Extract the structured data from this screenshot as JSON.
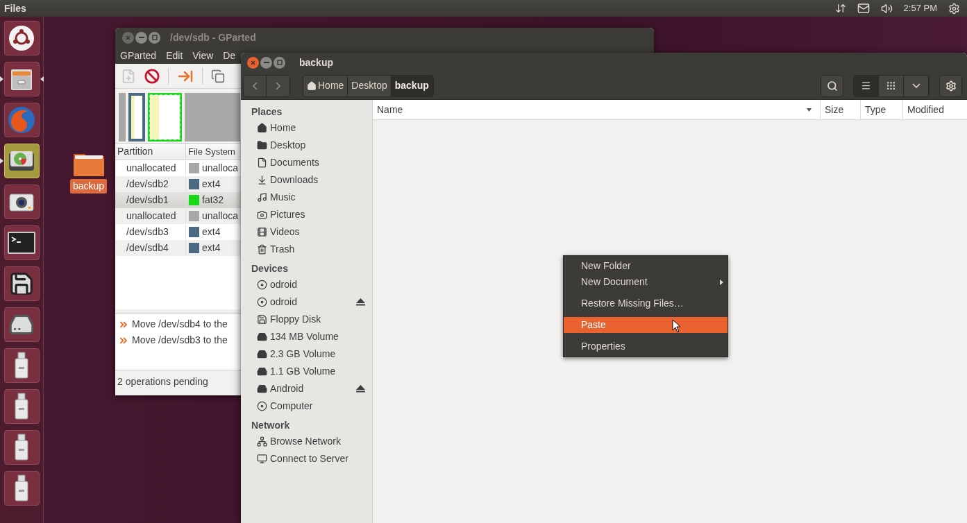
{
  "top_bar": {
    "app_name": "Files",
    "clock": "2:57 PM"
  },
  "launcher": [
    {
      "kind": "dash",
      "running": false,
      "focused": false
    },
    {
      "kind": "files",
      "running": true,
      "focused": true
    },
    {
      "kind": "browser",
      "running": false,
      "focused": false
    },
    {
      "kind": "gparted",
      "running": true,
      "focused": false
    },
    {
      "kind": "camera",
      "running": false,
      "focused": false
    },
    {
      "kind": "terminal",
      "running": false,
      "focused": false
    },
    {
      "kind": "floppy",
      "running": false,
      "focused": false
    },
    {
      "kind": "disk",
      "running": false,
      "focused": false
    },
    {
      "kind": "usb",
      "running": false,
      "focused": false
    },
    {
      "kind": "usb",
      "running": false,
      "focused": false
    },
    {
      "kind": "usb",
      "running": false,
      "focused": false
    },
    {
      "kind": "usb",
      "running": false,
      "focused": false
    }
  ],
  "desktop_icons": [
    {
      "label": "backup",
      "selected": true
    }
  ],
  "gparted": {
    "title": "/dev/sdb - GParted",
    "menu": [
      "GParted",
      "Edit",
      "View",
      "De"
    ],
    "columns": [
      "Partition",
      "File System"
    ],
    "rows": [
      {
        "partition": "unallocated",
        "filesystem": "unalloca",
        "color": "#a8a8a8",
        "selected": false
      },
      {
        "partition": "/dev/sdb2",
        "filesystem": "ext4",
        "color": "#4b6983",
        "selected": false
      },
      {
        "partition": "/dev/sdb1",
        "filesystem": "fat32",
        "color": "#18d918",
        "selected": true
      },
      {
        "partition": "unallocated",
        "filesystem": "unalloca",
        "color": "#a8a8a8",
        "selected": false
      },
      {
        "partition": "/dev/sdb3",
        "filesystem": "ext4",
        "color": "#4b6983",
        "selected": false
      },
      {
        "partition": "/dev/sdb4",
        "filesystem": "ext4",
        "color": "#4b6983",
        "selected": false
      }
    ],
    "operations": [
      "Move /dev/sdb4 to the",
      "Move /dev/sdb3 to the"
    ],
    "status": "2 operations pending"
  },
  "files": {
    "title": "backup",
    "path": [
      {
        "label": "Home",
        "kind": "home",
        "selected": false
      },
      {
        "label": "Desktop",
        "kind": "folder",
        "selected": false
      },
      {
        "label": "backup",
        "kind": "folder",
        "selected": true
      }
    ],
    "view_buttons": [
      {
        "kind": "list",
        "selected": true
      },
      {
        "kind": "grid",
        "selected": false
      },
      {
        "kind": "menu",
        "selected": false
      }
    ],
    "sidebar": [
      {
        "heading": "Places",
        "items": [
          {
            "label": "Home",
            "kind": "home",
            "eject": false
          },
          {
            "label": "Desktop",
            "kind": "folder",
            "eject": false
          },
          {
            "label": "Documents",
            "kind": "document",
            "eject": false
          },
          {
            "label": "Downloads",
            "kind": "download",
            "eject": false
          },
          {
            "label": "Music",
            "kind": "music",
            "eject": false
          },
          {
            "label": "Pictures",
            "kind": "camera",
            "eject": false
          },
          {
            "label": "Videos",
            "kind": "film",
            "eject": false
          },
          {
            "label": "Trash",
            "kind": "trash",
            "eject": false
          }
        ]
      },
      {
        "heading": "Devices",
        "items": [
          {
            "label": "odroid",
            "kind": "drive",
            "eject": false
          },
          {
            "label": "odroid",
            "kind": "drive",
            "eject": true
          },
          {
            "label": "Floppy Disk",
            "kind": "floppy",
            "eject": false
          },
          {
            "label": "134 MB Volume",
            "kind": "volume",
            "eject": false
          },
          {
            "label": "2.3 GB Volume",
            "kind": "volume",
            "eject": false
          },
          {
            "label": "1.1 GB Volume",
            "kind": "volume",
            "eject": false
          },
          {
            "label": "Android",
            "kind": "volume",
            "eject": true
          },
          {
            "label": "Computer",
            "kind": "drive",
            "eject": false
          }
        ]
      },
      {
        "heading": "Network",
        "items": [
          {
            "label": "Browse Network",
            "kind": "network",
            "eject": false
          },
          {
            "label": "Connect to Server",
            "kind": "server",
            "eject": false
          }
        ]
      }
    ],
    "columns": [
      "Name",
      "Size",
      "Type",
      "Modified"
    ]
  },
  "context_menu": [
    [
      {
        "label": "New Folder",
        "submenu": false,
        "selected": false
      },
      {
        "label": "New Document",
        "submenu": true,
        "selected": false
      }
    ],
    [
      {
        "label": "Restore Missing Files…",
        "submenu": false,
        "selected": false
      }
    ],
    [
      {
        "label": "Paste",
        "submenu": false,
        "selected": true
      }
    ],
    [
      {
        "label": "Properties",
        "submenu": false,
        "selected": false
      }
    ]
  ]
}
